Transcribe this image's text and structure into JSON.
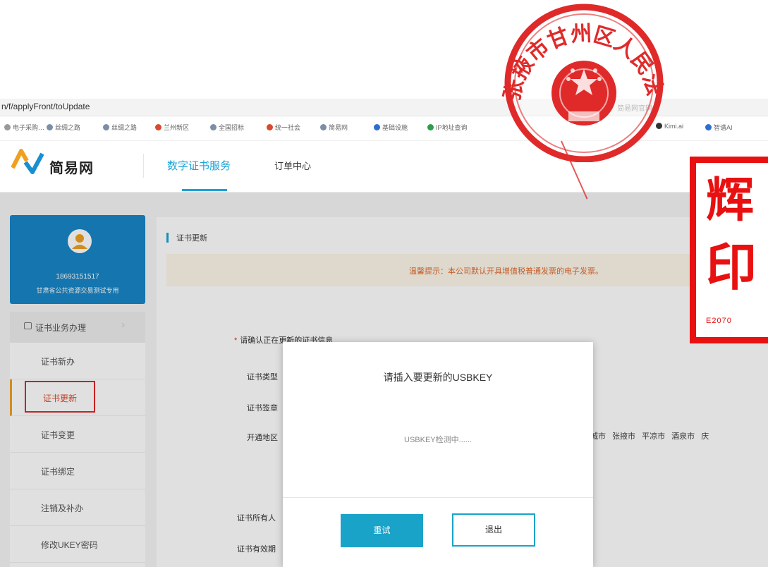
{
  "browser": {
    "url": "n/f/applyFront/toUpdate",
    "tab_title_right": "简易网官网",
    "bookmarks": [
      {
        "label": "电子采购…",
        "color": "#999999"
      },
      {
        "label": "丝绸之路",
        "color": "#7a8fa6"
      },
      {
        "label": "丝绸之路",
        "color": "#7a8fa6"
      },
      {
        "label": "兰州新区",
        "color": "#d94a2c"
      },
      {
        "label": "全国招标",
        "color": "#7a8fa6"
      },
      {
        "label": "统一社会",
        "color": "#d94a2c"
      },
      {
        "label": "简易网",
        "color": "#7a8fa6"
      },
      {
        "label": "基础设施",
        "color": "#2b6fd1"
      },
      {
        "label": "IP地址查询",
        "color": "#2aa04a"
      },
      {
        "label": "Kimi.ai",
        "color": "#333333"
      },
      {
        "label": "智谱AI",
        "color": "#2b6fd1"
      }
    ]
  },
  "header": {
    "logo_text": "简易网",
    "nav_cert": "数字证书服务",
    "nav_orders": "订单中心"
  },
  "user": {
    "phone": "18693151517",
    "org": "甘肃省公共资源交易测试专用"
  },
  "sidebar": {
    "group_label": "证书业务办理",
    "items": [
      {
        "label": "证书新办"
      },
      {
        "label": "证书更新"
      },
      {
        "label": "证书变更"
      },
      {
        "label": "证书绑定"
      },
      {
        "label": "注销及补办"
      },
      {
        "label": "修改UKEY密码"
      }
    ]
  },
  "main": {
    "title": "证书更新",
    "notice": "温馨提示：本公司默认开具增值税普通发票的电子发票。",
    "confirm_label": "请确认正在更新的证书信息",
    "fields": [
      {
        "label": "证书类型"
      },
      {
        "label": "证书签章"
      },
      {
        "label": "开通地区"
      },
      {
        "label": "证书所有人"
      },
      {
        "label": "证书有效期"
      }
    ],
    "regions": "城市 张掖市 平凉市 酒泉市 庆"
  },
  "modal": {
    "title": "请插入要更新的USBKEY",
    "status": "USBKEY检测中......",
    "retry_label": "重试",
    "exit_label": "退出"
  },
  "stamps": {
    "seal_text": "张掖市甘州区人民法院",
    "red_stamp_line1": "辉",
    "red_stamp_line2": "印",
    "red_stamp_code": "E2070"
  },
  "colors": {
    "accent": "#1aa3d5",
    "sidebar_card": "#1886c7",
    "stamp_red": "#e81010",
    "notice_text": "#e06a2c"
  }
}
